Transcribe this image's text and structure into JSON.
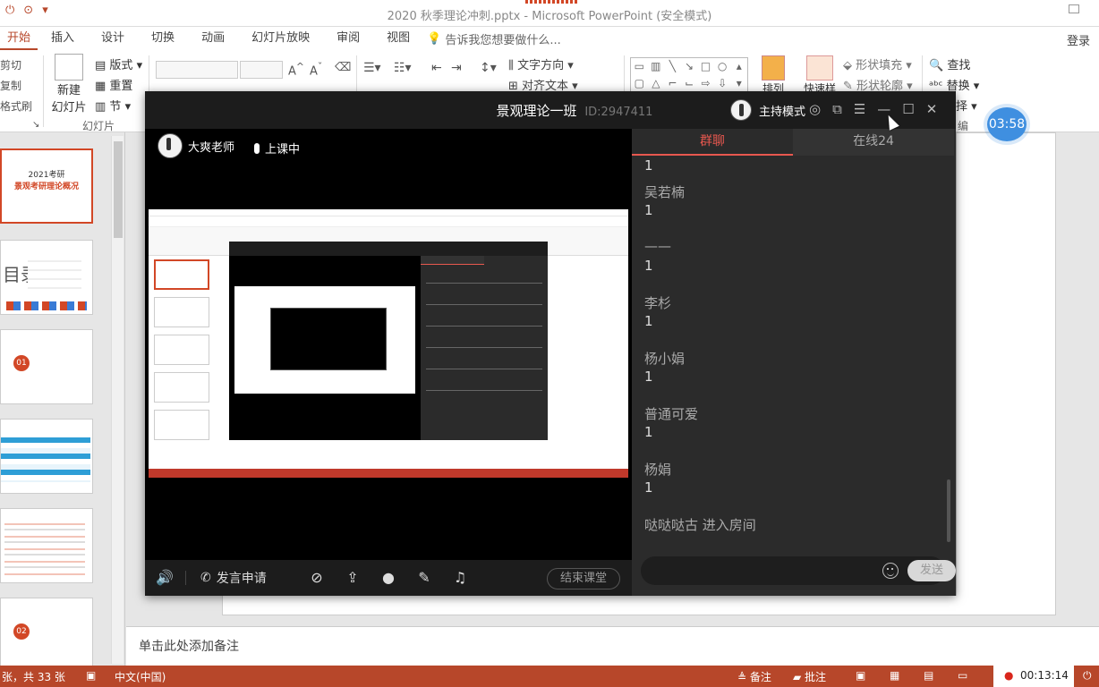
{
  "window": {
    "title": "2020 秋季理论冲刺.pptx - Microsoft PowerPoint (安全模式)"
  },
  "ribbon_tabs": [
    "开始",
    "插入",
    "设计",
    "切换",
    "动画",
    "幻灯片放映",
    "审阅",
    "视图"
  ],
  "tell_me": "告诉我您想要做什么...",
  "login": "登录",
  "ribbon": {
    "cut": "剪切",
    "copy": "复制",
    "format_painter": "格式刷",
    "new_slide_line1": "新建",
    "new_slide_line2": "幻灯片",
    "layout": "版式",
    "reset": "重置",
    "section": "节",
    "slides_group": "幻灯片",
    "text_direction": "文字方向",
    "align_text": "对齐文本",
    "shape_fill": "形状填充",
    "shape_outline": "形状轮廓",
    "find": "查找",
    "replace": "替换",
    "select": "择",
    "arrange": "排列",
    "quick_styles": "快速样式",
    "edit_group": "编"
  },
  "timer_badge": "03:58",
  "thumbnails": [
    {
      "title": "2021考研",
      "subtitle": "景观考研理论概况"
    },
    {
      "title": "目录",
      "subtitle": ""
    },
    {
      "title": "01",
      "subtitle": ""
    },
    {
      "title": "",
      "subtitle": ""
    },
    {
      "title": "",
      "subtitle": ""
    },
    {
      "title": "02",
      "subtitle": ""
    }
  ],
  "notes_placeholder": "单击此处添加备注",
  "statusbar": {
    "slide_count": "张，共 33 张",
    "language": "中文(中国)",
    "notes": "备注",
    "comments": "批注",
    "time": "00:13:14"
  },
  "live": {
    "class_name": "景观理论一班",
    "class_id": "ID:2947411",
    "host_mode": "主持模式",
    "teacher": "大爽老师",
    "status": "上课中",
    "speak_request": "发言申请",
    "end_class": "结束课堂",
    "tabs": [
      "群聊",
      "在线24"
    ],
    "messages": [
      {
        "name": "",
        "text": "1"
      },
      {
        "name": "吴若楠",
        "text": "1"
      },
      {
        "name": "——",
        "text": "1"
      },
      {
        "name": "李杉",
        "text": "1"
      },
      {
        "name": "杨小娟",
        "text": "1"
      },
      {
        "name": "普通可爱",
        "text": "1"
      },
      {
        "name": "杨娟",
        "text": "1"
      }
    ],
    "system_msg": "哒哒哒古 进入房间",
    "send": "发送"
  },
  "colors": {
    "pp_accent": "#b7472a",
    "chat_accent": "#e8584f",
    "timer_blue": "#3f8fe0"
  }
}
